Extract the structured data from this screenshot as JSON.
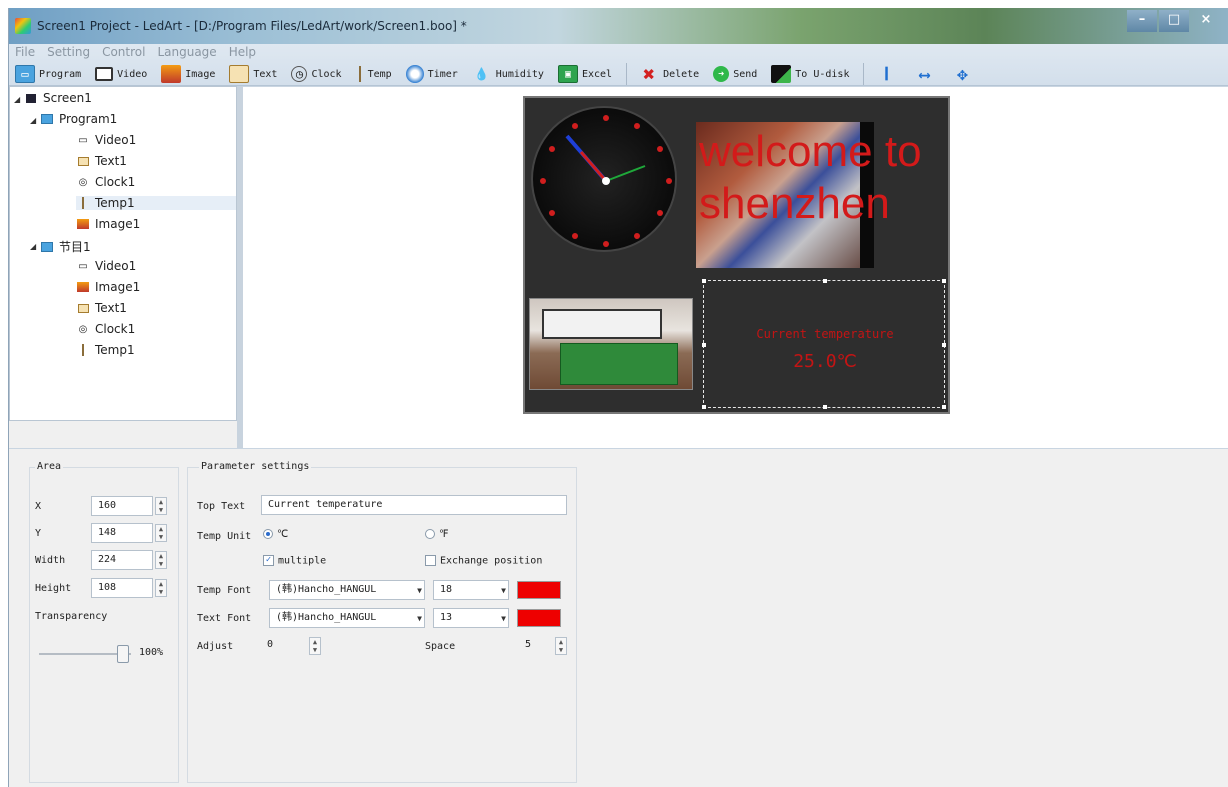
{
  "window": {
    "title": "Screen1 Project - LedArt - [D:/Program Files/LedArt/work/Screen1.boo] *",
    "buttons": {
      "minimize": "–",
      "maximize": "□",
      "close": "×"
    }
  },
  "menu": [
    "File",
    "Setting",
    "Control",
    "Language",
    "Help"
  ],
  "toolbar": [
    {
      "label": "Program",
      "icon": "program-icon"
    },
    {
      "label": "Video",
      "icon": "video-icon"
    },
    {
      "label": "Image",
      "icon": "image-icon"
    },
    {
      "label": "Text",
      "icon": "text-icon"
    },
    {
      "label": "Clock",
      "icon": "clock-icon"
    },
    {
      "label": "Temp",
      "icon": "temp-icon"
    },
    {
      "label": "Timer",
      "icon": "timer-icon"
    },
    {
      "label": "Humidity",
      "icon": "humidity-icon"
    },
    {
      "label": "Excel",
      "icon": "excel-icon"
    },
    {
      "label": "Delete",
      "icon": "delete-icon"
    },
    {
      "label": "Send",
      "icon": "send-icon"
    },
    {
      "label": "To U-disk",
      "icon": "udisk-icon"
    }
  ],
  "tree": {
    "root": "Screen1",
    "programs": [
      {
        "name": "Program1",
        "items": [
          "Video1",
          "Text1",
          "Clock1",
          "Temp1",
          "Image1"
        ]
      },
      {
        "name": "节目1",
        "items": [
          "Video1",
          "Image1",
          "Text1",
          "Clock1",
          "Temp1"
        ]
      }
    ],
    "selected": "Temp1"
  },
  "stage": {
    "welcome_text": "welcome to shenzhen",
    "temp_caption": "Current temperature",
    "temp_value": "25.0℃"
  },
  "area": {
    "title": "Area",
    "x_label": "X",
    "x_value": "160",
    "y_label": "Y",
    "y_value": "148",
    "width_label": "Width",
    "width_value": "224",
    "height_label": "Height",
    "height_value": "108",
    "transparency_label": "Transparency",
    "transparency_value": "100%"
  },
  "params": {
    "title": "Parameter settings",
    "top_text_label": "Top Text",
    "top_text_value": "Current temperature",
    "temp_unit_label": "Temp Unit",
    "unit_c": "℃",
    "unit_f": "℉",
    "multiple_label": "multiple",
    "exchange_label": "Exchange position",
    "temp_font_label": "Temp Font",
    "temp_font_value": "(韩)Hancho_HANGUL",
    "temp_font_size": "18",
    "text_font_label": "Text Font",
    "text_font_value": "(韩)Hancho_HANGUL",
    "text_font_size": "13",
    "adjust_label": "Adjust",
    "adjust_value": "0",
    "space_label": "Space",
    "space_value": "5",
    "color_temp": "#ee0000",
    "color_text": "#ee0000"
  }
}
